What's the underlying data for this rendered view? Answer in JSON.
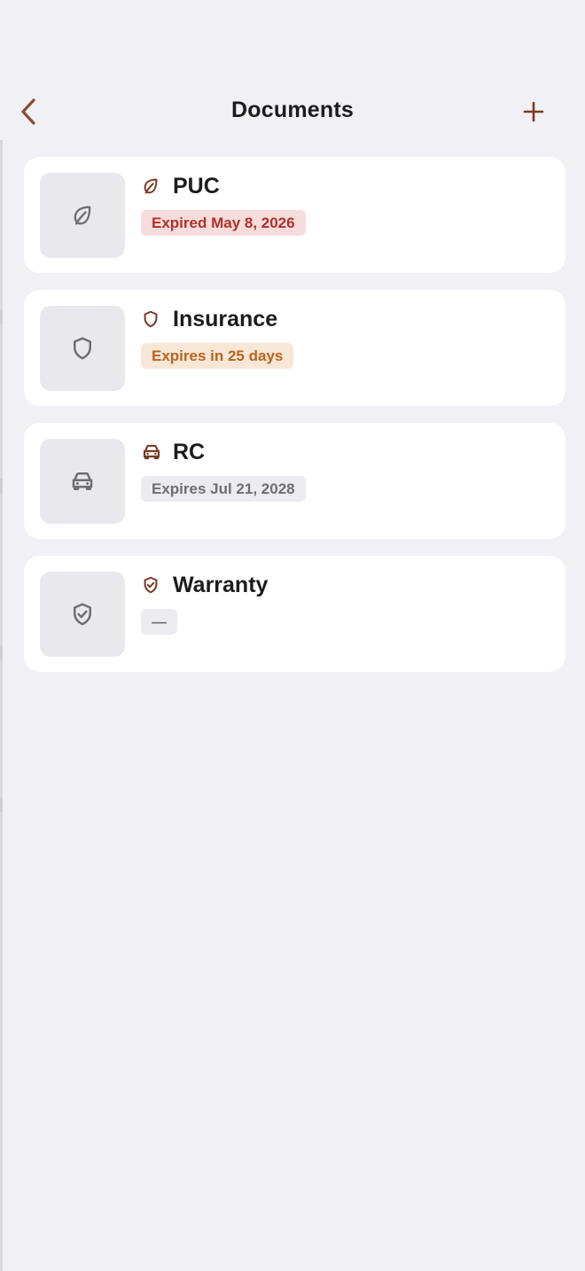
{
  "header": {
    "title": "Documents"
  },
  "icons": {
    "back": "chevron-left-icon",
    "add": "plus-icon",
    "puc": "leaf-icon",
    "insurance": "shield-icon",
    "rc": "car-icon",
    "warranty": "shield-check-icon"
  },
  "colors": {
    "background": "#f1f0f5",
    "card": "#ffffff",
    "thumbnail": "#e9e9ed",
    "accent": "#7a3a22",
    "expired_text": "#b3302a",
    "expired_bg": "#f7dcdc",
    "warning_text": "#b8651f",
    "warning_bg": "#f8e6d6",
    "neutral_text": "#6d6d72",
    "neutral_bg": "#ececf0"
  },
  "documents": [
    {
      "title": "PUC",
      "status": "Expired May 8, 2026",
      "status_type": "expired"
    },
    {
      "title": "Insurance",
      "status": "Expires in 25 days",
      "status_type": "warning"
    },
    {
      "title": "RC",
      "status": "Expires Jul 21, 2028",
      "status_type": "neutral"
    },
    {
      "title": "Warranty",
      "status": "—",
      "status_type": "neutral"
    }
  ]
}
